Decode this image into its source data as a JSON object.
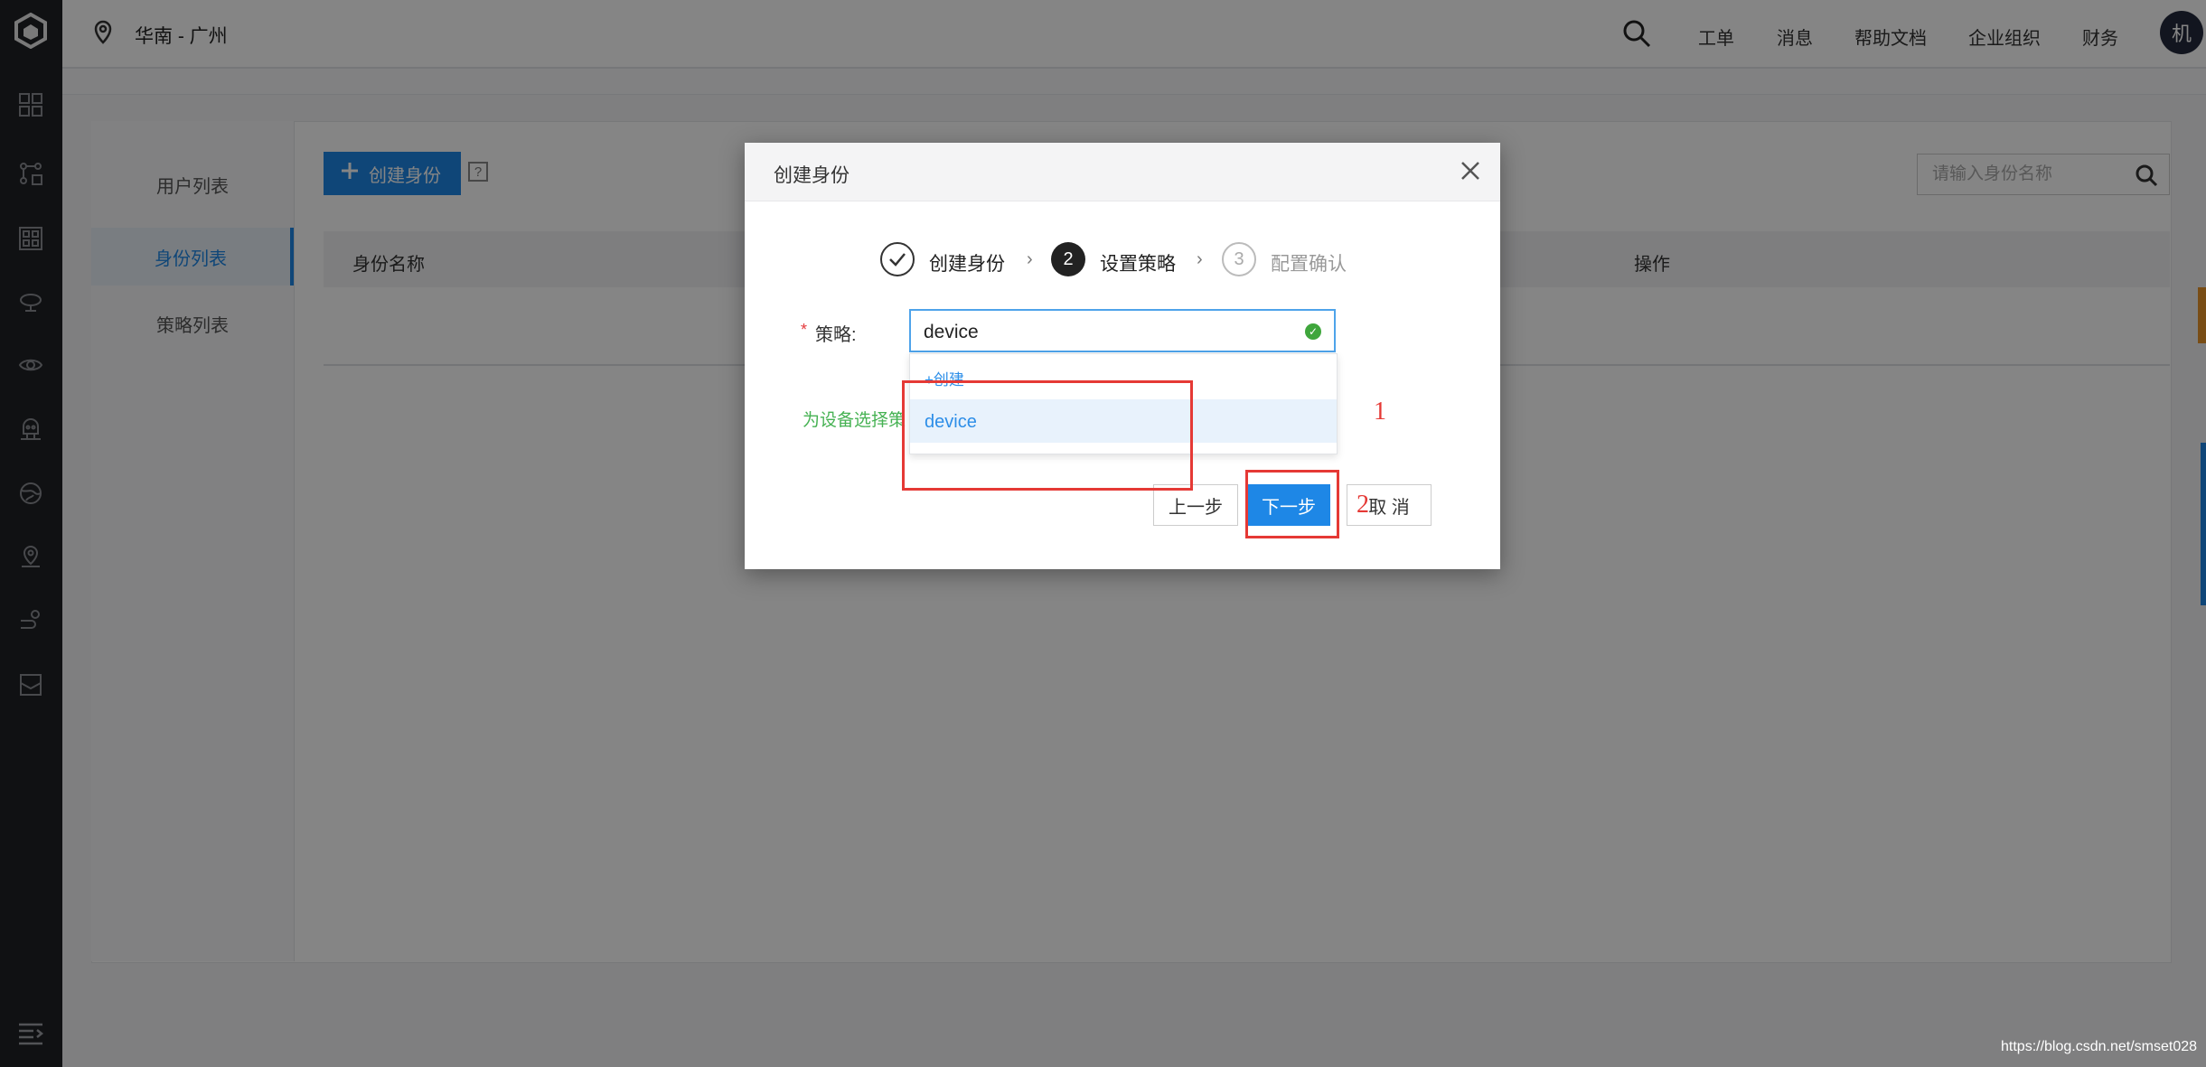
{
  "topbar": {
    "region": "华南 - 广州",
    "nav": [
      "工单",
      "消息",
      "帮助文档",
      "企业组织",
      "财务"
    ],
    "avatar": "机"
  },
  "sidebar": {
    "icons": [
      "logo-icon",
      "grid-icon",
      "network-icon",
      "qr-icon",
      "cloud-icon",
      "eye-icon",
      "robot-icon",
      "globe-icon",
      "location-icon",
      "flow-icon",
      "inbox-icon",
      "menu-expand-icon"
    ]
  },
  "subnav": {
    "items": [
      {
        "label": "用户列表",
        "active": false
      },
      {
        "label": "身份列表",
        "active": true
      },
      {
        "label": "策略列表",
        "active": false
      }
    ]
  },
  "toolbar": {
    "create_label": "创建身份",
    "help": "?",
    "search_placeholder": "请输入身份名称"
  },
  "table": {
    "headers": [
      "身份名称",
      "操作"
    ]
  },
  "modal": {
    "title": "创建身份",
    "steps": [
      {
        "number": "1",
        "label": "创建身份",
        "state": "done"
      },
      {
        "number": "2",
        "label": "设置策略",
        "state": "active"
      },
      {
        "number": "3",
        "label": "配置确认",
        "state": "pending"
      }
    ],
    "field_required": "*",
    "field_label": "策略:",
    "select_value": "device",
    "dropdown": {
      "create_label": "+创建",
      "options": [
        "device"
      ]
    },
    "hint": "为设备选择策",
    "buttons": {
      "prev": "上一步",
      "next": "下一步",
      "cancel": "取 消"
    }
  },
  "annotations": [
    "1",
    "2"
  ],
  "watermark": "https://blog.csdn.net/smset028",
  "colors": {
    "primary": "#1e87e6",
    "rail": "#1f2125",
    "success": "#3fa63c",
    "hint": "#46b253",
    "annotation": "#e53935"
  }
}
